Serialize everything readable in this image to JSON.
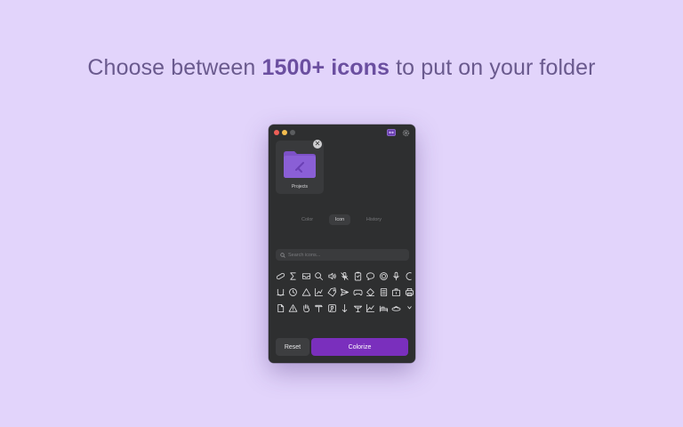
{
  "headline": {
    "prefix": "Choose between ",
    "emphasis": "1500+ icons",
    "suffix": " to put on your folder"
  },
  "window": {
    "folder": {
      "name": "Projects",
      "color": "#8a5fd6"
    },
    "tabs": [
      {
        "label": "Color",
        "active": false
      },
      {
        "label": "Icon",
        "active": true
      },
      {
        "label": "History",
        "active": false
      }
    ],
    "search": {
      "placeholder": "Search icons...",
      "value": ""
    },
    "icons": [
      "bandage-icon",
      "sum-icon",
      "inbox-icon",
      "magnifier-icon",
      "speaker-icon",
      "mic-slash-icon",
      "clipboard-icon",
      "speech-bubble-icon",
      "target-icon",
      "mic-icon",
      "circle-partial-icon",
      "magnet-icon",
      "clock-icon",
      "triangle-icon",
      "chart-scatter-icon",
      "tag-icon",
      "send-icon",
      "gamepad-icon",
      "eraser-icon",
      "list-doc-icon",
      "briefcase-icon",
      "printer-icon",
      "doc-icon",
      "warning-icon",
      "hand-icon",
      "hammer-icon",
      "image-icon",
      "arrow-down-icon",
      "lamp-icon",
      "line-chart-icon",
      "bed-icon",
      "ufo-icon",
      "chevron-icon"
    ],
    "buttons": {
      "reset": "Reset",
      "colorize": "Colorize"
    },
    "colors": {
      "accent": "#7a2fbd",
      "background": "#e2d4fb"
    }
  }
}
